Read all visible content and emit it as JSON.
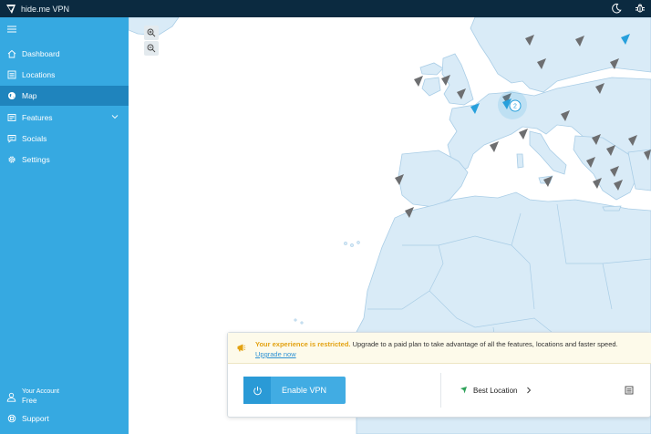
{
  "app": {
    "title": "hide.me VPN"
  },
  "titlebar": {
    "icons": [
      "hide-me-logo-icon",
      "moon-icon",
      "bug-icon"
    ]
  },
  "sidebar": {
    "items": [
      {
        "label": "Dashboard",
        "icon": "home-icon"
      },
      {
        "label": "Locations",
        "icon": "list-icon"
      },
      {
        "label": "Map",
        "icon": "globe-icon",
        "active": true
      },
      {
        "label": "Features",
        "icon": "features-icon",
        "expandable": true
      },
      {
        "label": "Socials",
        "icon": "chat-icon"
      },
      {
        "label": "Settings",
        "icon": "gear-icon"
      }
    ],
    "account": {
      "title": "Your Account",
      "plan": "Free"
    },
    "support": {
      "label": "Support"
    }
  },
  "map": {
    "zoom_in_icon": "zoom-in-icon",
    "zoom_out_icon": "zoom-out-icon",
    "cluster_count": "2"
  },
  "notice": {
    "strong": "Your experience is restricted.",
    "text": " Upgrade to a paid plan to take advantage of all the features, locations and faster speed.",
    "link": "Upgrade now"
  },
  "vpn": {
    "enable_label": "Enable VPN",
    "location_label": "Best Location"
  },
  "colors": {
    "titlebar": "#0b2a40",
    "sidebar": "#36a9e1",
    "sidebar_active": "#1f84bd",
    "land": "#d9ebf7",
    "border": "#a9cde6",
    "free_server": "#6d6e70",
    "available_server": "#27a0dc",
    "warning": "#e3a212"
  }
}
